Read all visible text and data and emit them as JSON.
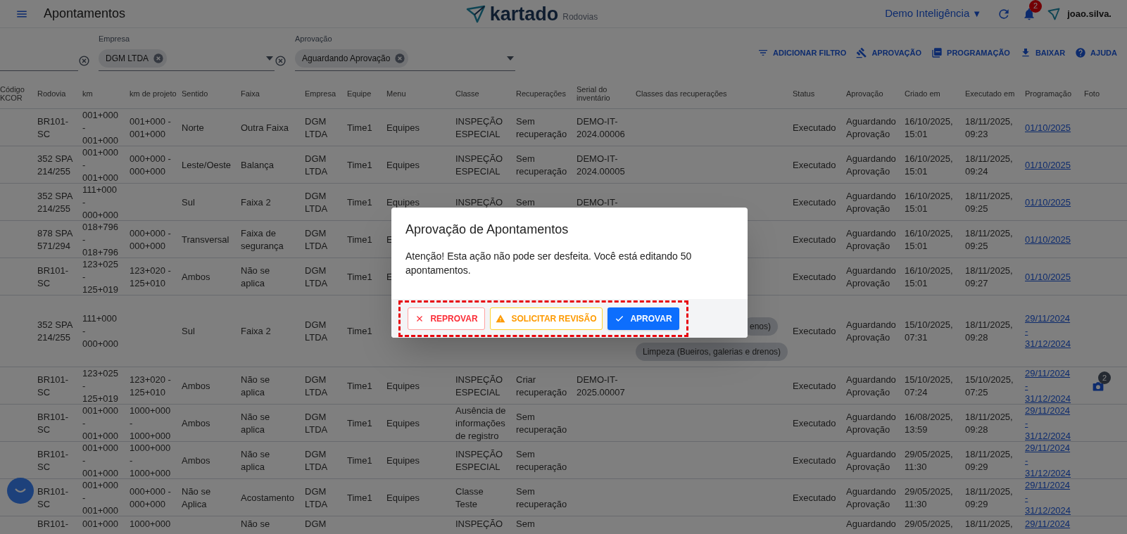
{
  "header": {
    "title": "Apontamentos",
    "logo": "kartado",
    "logo_sub": "Rodovias",
    "workspace": "Demo Inteligência",
    "workspace_caret": "▼",
    "notifications": "2",
    "user": "joao.silva."
  },
  "filters": [
    {
      "label": "Empresa",
      "chip": "DGM LTDA"
    },
    {
      "label": "Aprovação",
      "chip": "Aguardando Aprovação"
    }
  ],
  "actions": [
    {
      "label": "ADICIONAR FILTRO"
    },
    {
      "label": "APROVAÇÃO"
    },
    {
      "label": "PROGRAMAÇÃO"
    },
    {
      "label": "BAIXAR"
    },
    {
      "label": "AJUDA"
    }
  ],
  "table": {
    "columns": [
      {
        "label": "Código KCOR",
        "kind": "text"
      },
      {
        "label": "Rodovia",
        "kind": "text"
      },
      {
        "label": "km",
        "kind": "text"
      },
      {
        "label": "km de projeto",
        "kind": "text"
      },
      {
        "label": "Sentido",
        "kind": "text"
      },
      {
        "label": "Faixa",
        "kind": "text"
      },
      {
        "label": "Empresa",
        "kind": "text"
      },
      {
        "label": "Equipe",
        "kind": "text"
      },
      {
        "label": "Menu",
        "kind": "text"
      },
      {
        "label": "Classe",
        "kind": "text"
      },
      {
        "label": "Recuperações",
        "kind": "text"
      },
      {
        "label": "Serial do inventário",
        "kind": "text"
      },
      {
        "label": "Classes das recuperações",
        "kind": "chips"
      },
      {
        "label": "Status",
        "kind": "text"
      },
      {
        "label": "Aprovação",
        "kind": "text"
      },
      {
        "label": "Criado em",
        "kind": "text"
      },
      {
        "label": "Executado em",
        "kind": "text"
      },
      {
        "label": "Programação",
        "kind": "link"
      },
      {
        "label": "Foto",
        "kind": "photo"
      }
    ],
    "rows": [
      {
        "cells": [
          null,
          "BR101-\nSC",
          "001+000\n-\n001+000",
          "001+000 -\n001+000",
          "Norte",
          "Outra Faixa",
          "DGM\nLTDA",
          "Time1",
          "Equipes",
          "INSPEÇÃO\nESPECIAL",
          "Sem\nrecuperação",
          "DEMO-IT-\n2024.00006",
          null,
          "Executado",
          "Aguardando\nAprovação",
          "16/10/2025,\n15:01",
          "18/11/2025,\n09:23",
          "01/10/2025",
          null
        ]
      },
      {
        "cells": [
          null,
          "352 SPA\n214/255",
          "001+000\n-\n001+000",
          "000+000 -\n000+000",
          "Leste/Oeste",
          "Balança",
          "DGM\nLTDA",
          "Time1",
          "Equipes",
          "INSPEÇÃO\nESPECIAL",
          "Sem\nrecuperação",
          "DEMO-IT-\n2024.00005",
          null,
          "Executado",
          "Aguardando\nAprovação",
          "16/10/2025,\n15:01",
          "18/11/2025,\n09:24",
          "01/10/2025",
          null
        ]
      },
      {
        "cells": [
          null,
          "352 SPA\n214/255",
          "111+000\n-\n000+000",
          null,
          "Sul",
          "Faixa 2",
          "DGM\nLTDA",
          "Time1",
          "Equipes",
          "INSPEÇÃO",
          "Sem",
          "DEMO-IT-",
          null,
          "Executado",
          "Aguardando\nAprovação",
          "16/10/2025,\n15:01",
          "18/11/2025,\n09:25",
          "01/10/2025",
          null
        ]
      },
      {
        "cells": [
          null,
          "878 SPA\n571/294",
          "018+796\n-\n018+796",
          "000+000 -\n000+000",
          "Transversal",
          "Faixa de\nsegurança",
          "DGM\nLTDA",
          "Time1",
          "E",
          null,
          null,
          null,
          null,
          "Executado",
          "Aguardando\nAprovação",
          "16/10/2025,\n15:01",
          "18/11/2025,\n09:25",
          "01/10/2025",
          null
        ]
      },
      {
        "cells": [
          null,
          "BR101-\nSC",
          "123+025\n-\n125+019",
          "123+020 -\n125+010",
          "Ambos",
          "Não se\naplica",
          "DGM\nLTDA",
          "Time1",
          "E",
          null,
          null,
          null,
          null,
          "Executado",
          "Aguardando\nAprovação",
          "16/10/2025,\n15:01",
          "18/11/2025,\n09:27",
          "01/10/2025",
          null
        ]
      },
      {
        "chips": [
          "enos)",
          "Limpeza (Bueiros, galerias e drenos)"
        ],
        "cells": [
          null,
          "352 SPA\n214/255",
          "111+000\n-\n000+000",
          null,
          "Sul",
          "Faixa 2",
          "DGM\nLTDA",
          "Time1",
          null,
          null,
          null,
          null,
          null,
          "Executado",
          "Aguardando\nAprovação",
          "15/10/2025,\n07:31",
          "18/11/2025,\n09:28",
          "29/11/2024\n-\n31/12/2024",
          null
        ]
      },
      {
        "photo_count": "2",
        "cells": [
          null,
          "BR101-\nSC",
          "123+025\n-\n125+019",
          "123+020 -\n125+010",
          "Ambos",
          "Não se\naplica",
          "DGM\nLTDA",
          "Time1",
          "Equipes",
          "INSPEÇÃO\nESPECIAL",
          "Criar\nrecuperação",
          "DEMO-IT-\n2025.00007",
          null,
          "Executado",
          "Aguardando\nAprovação",
          "15/10/2025,\n07:24",
          "15/10/2025,\n07:25",
          "29/11/2024\n-\n31/12/2024",
          null
        ]
      },
      {
        "cells": [
          null,
          "BR101-\nSC",
          "001+000\n-\n001+000",
          "1000+000\n-\n1000+000",
          "Ambos",
          "Não se\naplica",
          "DGM\nLTDA",
          "Time1",
          "Equipes",
          "Ausência de\ninformações\nde registro",
          "Sem\nrecuperação",
          null,
          null,
          "Executado",
          "Aguardando\nAprovação",
          "16/08/2025,\n13:59",
          "18/11/2025,\n09:28",
          "29/11/2024\n-\n31/12/2024",
          null
        ]
      },
      {
        "cells": [
          null,
          "BR101-\nSC",
          "001+000\n-\n001+000",
          "1000+000\n-\n1000+000",
          "Ambos",
          "Não se\naplica",
          "DGM\nLTDA",
          "Time1",
          "Equipes",
          "INSPEÇÃO\nESPECIAL",
          "Sem\nrecuperação",
          null,
          null,
          "Executado",
          "Aguardando\nAprovação",
          "29/05/2025,\n11:30",
          "18/11/2025,\n09:29",
          "29/11/2024\n-\n31/12/2024",
          null
        ]
      },
      {
        "cells": [
          null,
          "BR101-\nSC",
          "001+000\n-\n001+000",
          "000+000 -\n000+000",
          "Não se\nAplica",
          "Acostamento",
          "DGM\nLTDA",
          "Time1",
          "Equipes",
          "Classe\nTeste",
          "Sem\nrecuperação",
          null,
          null,
          "Executado",
          "Aguardando\nAprovação",
          "29/05/2025,\n11:30",
          "18/11/2025,\n09:29",
          "29/11/2024\n-\n31/12/2024",
          null
        ]
      },
      {
        "cells": [
          null,
          "BR101-",
          "001+000",
          "1000+000",
          null,
          "Não se",
          "DGM",
          null,
          null,
          "INSPEÇÃO",
          "Sem",
          null,
          null,
          null,
          "Aguardando",
          "29/05/2025,",
          "18/11/2025,",
          "29/11/2024",
          null
        ]
      }
    ]
  },
  "dialog": {
    "title": "Aprovação de Apontamentos",
    "message": "Atenção! Esta ação não pode ser desfeita. Você está editando 50 apontamentos.",
    "highlighted": true,
    "buttons": [
      {
        "label": "REPROVAR",
        "kind": "reject"
      },
      {
        "label": "SOLICITAR REVISÃO",
        "kind": "review"
      },
      {
        "label": "APROVAR",
        "kind": "approve"
      }
    ]
  }
}
